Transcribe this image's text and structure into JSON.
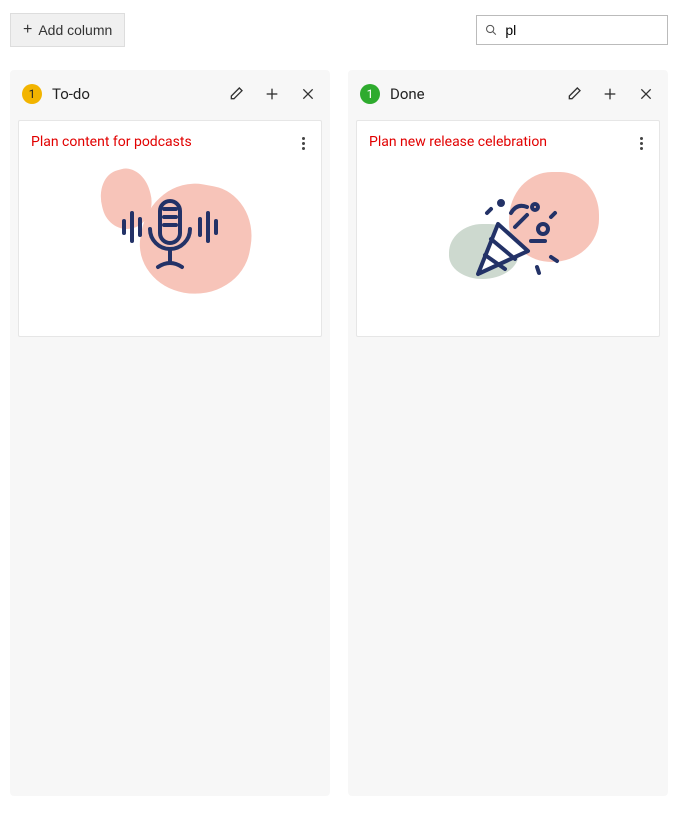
{
  "toolbar": {
    "add_column_label": "Add column",
    "search_value": "pl",
    "search_placeholder": ""
  },
  "columns": [
    {
      "count": "1",
      "badge_color": "yellow",
      "title": "To-do",
      "card": {
        "title": "Plan content for podcasts",
        "illustration": "microphone"
      }
    },
    {
      "count": "1",
      "badge_color": "green",
      "title": "Done",
      "card": {
        "title": "Plan new release celebration",
        "illustration": "party"
      }
    }
  ]
}
